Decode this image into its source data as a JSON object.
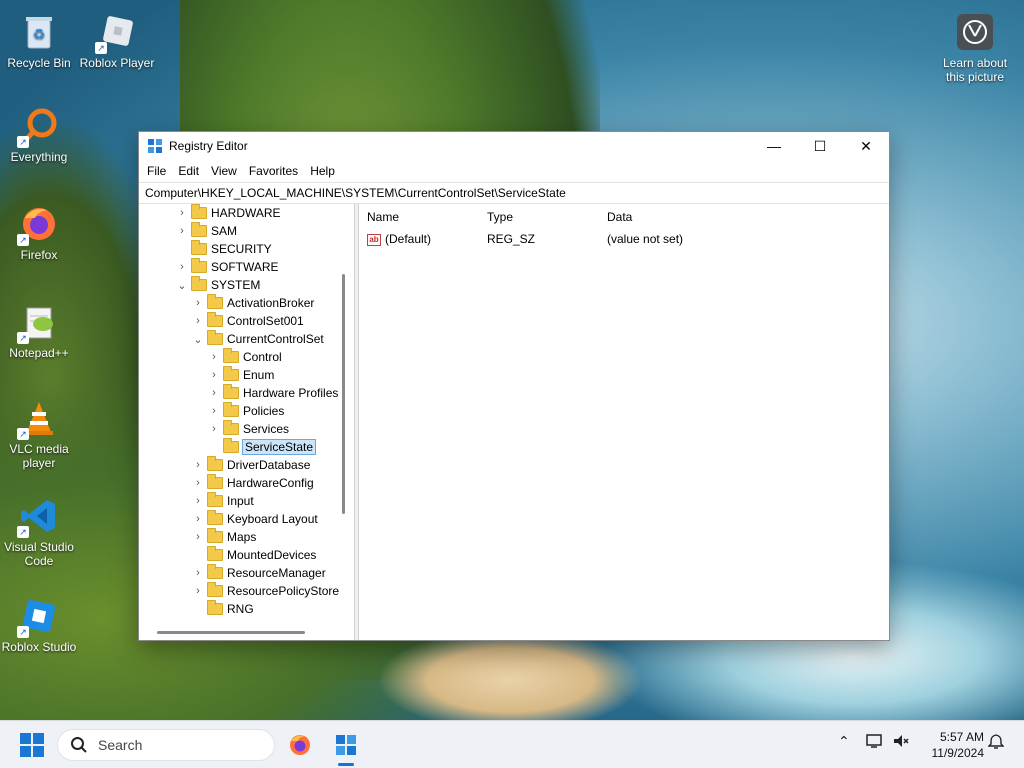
{
  "desktop": {
    "icons": [
      {
        "label": "Recycle Bin"
      },
      {
        "label": "Roblox Player"
      },
      {
        "label": "Everything"
      },
      {
        "label": "Firefox"
      },
      {
        "label": "Notepad++"
      },
      {
        "label": "VLC media player"
      },
      {
        "label": "Visual Studio Code"
      },
      {
        "label": "Roblox Studio"
      }
    ],
    "learn": {
      "label": "Learn about this picture"
    }
  },
  "window": {
    "title": "Registry Editor",
    "menu": [
      "File",
      "Edit",
      "View",
      "Favorites",
      "Help"
    ],
    "address": "Computer\\HKEY_LOCAL_MACHINE\\SYSTEM\\CurrentControlSet\\ServiceState",
    "tree": [
      {
        "label": "HARDWARE",
        "expander": "›"
      },
      {
        "label": "SAM",
        "expander": "›"
      },
      {
        "label": "SECURITY",
        "expander": ""
      },
      {
        "label": "SOFTWARE",
        "expander": "›"
      },
      {
        "label": "SYSTEM",
        "expander": "⌄"
      },
      {
        "label": "ActivationBroker",
        "expander": "›"
      },
      {
        "label": "ControlSet001",
        "expander": "›"
      },
      {
        "label": "CurrentControlSet",
        "expander": "⌄"
      },
      {
        "label": "Control",
        "expander": "›"
      },
      {
        "label": "Enum",
        "expander": "›"
      },
      {
        "label": "Hardware Profiles",
        "expander": "›"
      },
      {
        "label": "Policies",
        "expander": "›"
      },
      {
        "label": "Services",
        "expander": "›"
      },
      {
        "label": "ServiceState",
        "expander": ""
      },
      {
        "label": "DriverDatabase",
        "expander": "›"
      },
      {
        "label": "HardwareConfig",
        "expander": "›"
      },
      {
        "label": "Input",
        "expander": "›"
      },
      {
        "label": "Keyboard Layout",
        "expander": "›"
      },
      {
        "label": "Maps",
        "expander": "›"
      },
      {
        "label": "MountedDevices",
        "expander": ""
      },
      {
        "label": "ResourceManager",
        "expander": "›"
      },
      {
        "label": "ResourcePolicyStore",
        "expander": "›"
      },
      {
        "label": "RNG",
        "expander": ""
      }
    ],
    "list": {
      "headers": {
        "name": "Name",
        "type": "Type",
        "data": "Data"
      },
      "rows": [
        {
          "name": "(Default)",
          "type": "REG_SZ",
          "data": "(value not set)"
        }
      ]
    }
  },
  "taskbar": {
    "search_placeholder": "Search",
    "time": "5:57 AM",
    "date": "11/9/2024"
  },
  "colors": {
    "accent": "#1a78d4",
    "selection": "#cce4f7",
    "folder": "#f3c94a"
  }
}
